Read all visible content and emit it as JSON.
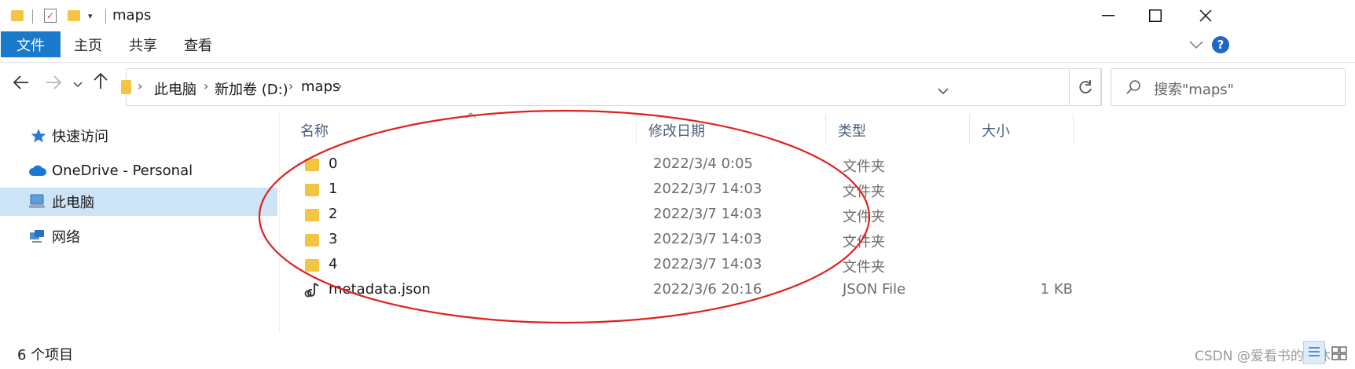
{
  "window": {
    "title": "maps",
    "quick_access_icons": [
      "folder-icon",
      "properties-icon",
      "new-folder-icon",
      "customize-arrow-icon"
    ]
  },
  "ribbon": {
    "tabs": [
      {
        "label": "文件",
        "active": true
      },
      {
        "label": "主页",
        "active": false
      },
      {
        "label": "共享",
        "active": false
      },
      {
        "label": "查看",
        "active": false
      }
    ]
  },
  "address_bar": {
    "breadcrumbs": [
      "此电脑",
      "新加卷 (D:)",
      "maps"
    ]
  },
  "search": {
    "placeholder": "搜索\"maps\""
  },
  "sidebar": {
    "items": [
      {
        "label": "快速访问",
        "icon": "star-icon"
      },
      {
        "label": "OneDrive - Personal",
        "icon": "cloud-icon"
      },
      {
        "label": "此电脑",
        "icon": "computer-icon",
        "selected": true
      },
      {
        "label": "网络",
        "icon": "network-icon"
      }
    ]
  },
  "file_list": {
    "columns": [
      "名称",
      "修改日期",
      "类型",
      "大小"
    ],
    "rows": [
      {
        "name": "0",
        "date": "2022/3/4 0:05",
        "type": "文件夹",
        "size": "",
        "icon": "folder-icon"
      },
      {
        "name": "1",
        "date": "2022/3/7 14:03",
        "type": "文件夹",
        "size": "",
        "icon": "folder-icon"
      },
      {
        "name": "2",
        "date": "2022/3/7 14:03",
        "type": "文件夹",
        "size": "",
        "icon": "folder-icon"
      },
      {
        "name": "3",
        "date": "2022/3/7 14:03",
        "type": "文件夹",
        "size": "",
        "icon": "folder-icon"
      },
      {
        "name": "4",
        "date": "2022/3/7 14:03",
        "type": "文件夹",
        "size": "",
        "icon": "folder-icon"
      },
      {
        "name": "metadata.json",
        "date": "2022/3/6 20:16",
        "type": "JSON File",
        "size": "1 KB",
        "icon": "json-file-icon"
      }
    ]
  },
  "status_bar": {
    "item_count": "6 个项目"
  },
  "watermark": "CSDN @爱看书的小沐",
  "colors": {
    "accent": "#1979ca",
    "selection": "#cde4f7",
    "annotation": "#e02020",
    "folder": "#f4c542"
  }
}
